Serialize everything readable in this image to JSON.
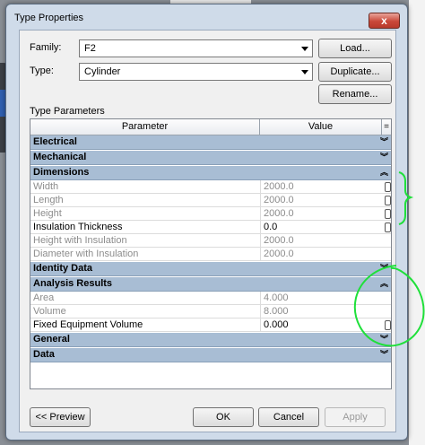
{
  "dialog": {
    "title": "Type Properties",
    "close_glyph": "x"
  },
  "family": {
    "label": "Family:",
    "value": "F2"
  },
  "type": {
    "label": "Type:",
    "value": "Cylinder"
  },
  "buttons": {
    "load": "Load...",
    "duplicate": "Duplicate...",
    "rename": "Rename...",
    "preview": "<< Preview",
    "ok": "OK",
    "cancel": "Cancel",
    "apply": "Apply"
  },
  "type_parameters": {
    "label": "Type Parameters",
    "headers": {
      "parameter": "Parameter",
      "value": "Value",
      "sort": "="
    },
    "groups": {
      "electrical": "Electrical",
      "mechanical": "Mechanical",
      "dimensions": "Dimensions",
      "identity": "Identity Data",
      "analysis": "Analysis Results",
      "general": "General",
      "data": "Data"
    },
    "rows": {
      "width": {
        "name": "Width",
        "value": "2000.0"
      },
      "length": {
        "name": "Length",
        "value": "2000.0"
      },
      "height": {
        "name": "Height",
        "value": "2000.0"
      },
      "insulation": {
        "name": "Insulation Thickness",
        "value": "0.0"
      },
      "height_ins": {
        "name": "Height with Insulation",
        "value": "2000.0"
      },
      "diameter_ins": {
        "name": "Diameter with Insulation",
        "value": "2000.0"
      },
      "area": {
        "name": "Area",
        "value": "4.000"
      },
      "volume": {
        "name": "Volume",
        "value": "8.000"
      },
      "fixed_volume": {
        "name": "Fixed Equipment Volume",
        "value": "0.000"
      }
    }
  },
  "colors": {
    "group_header": "#a8bdd4",
    "annotation": "#1fe03a",
    "close_button": "#c9483a"
  }
}
